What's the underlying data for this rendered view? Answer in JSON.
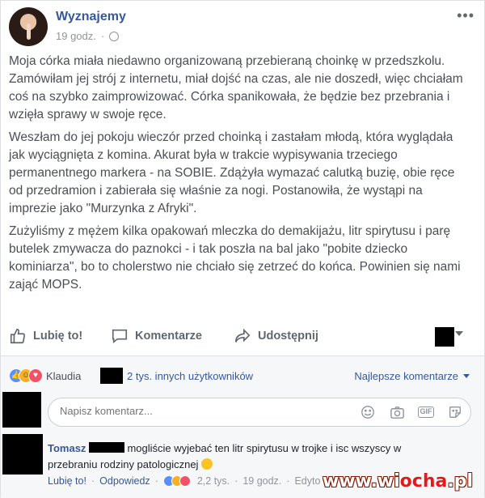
{
  "post": {
    "page_name": "Wyznajemy",
    "time": "19 godz.",
    "paragraphs": [
      "Moja córka miała niedawno organizowaną przebieraną choinkę w przedszkolu. Zamówiłam jej strój z internetu, miał dojść na czas, ale nie doszedł, więc chciałam coś na szybko zaimprowizować. Córka spanikowała, że będzie bez przebrania i wzięła sprawy w swoje ręce.",
      "Weszłam do jej pokoju wieczór przed choinką i zastałam młodą, która wyglądała jak wyciągnięta z komina. Akurat była w trakcie wypisywania trzeciego permanentnego markera - na SOBIE. Zdążyła wymazać calutką buzię, obie ręce od przedramion i zabierała się właśnie za nogi. Postanowiła, że wystąpi na imprezie jako \"Murzynka z Afryki\".",
      "Zużyliśmy z mężem kilka opakowań mleczka do demakijażu, litr spirytusu i parę butelek zmywacza do paznokci - i tak poszła na bal jako \"pobite dziecko kominiarza\", bo to cholerstwo nie chciało się zetrzeć do końca. Powinien się nami zająć MOPS."
    ]
  },
  "actions": {
    "like": "Lubię to!",
    "comment": "Komentarze",
    "share": "Udostępnij"
  },
  "reactions": {
    "name": "Klaudia",
    "others": "2 tys. innych użytkowników",
    "sort": "Najlepsze komentarze"
  },
  "composer": {
    "placeholder": "Napisz komentarz..."
  },
  "comment": {
    "author": "Tomasz",
    "text": "mogliście wyjebać ten litr spirytusu w trojke i isc wszyscy w przebraniu rodziny patologicznej",
    "like": "Lubię to!",
    "reply": "Odpowiedz",
    "reaction_count": "2,2 tys.",
    "time": "19 godz.",
    "edited": "Edyto"
  },
  "watermark": {
    "prefix": "www.wi",
    "red": "ocha",
    "suffix": ".pl"
  },
  "colors": {
    "link": "#365899",
    "like": "#5890ff",
    "love": "#f25268",
    "haha": "#f7b125"
  }
}
